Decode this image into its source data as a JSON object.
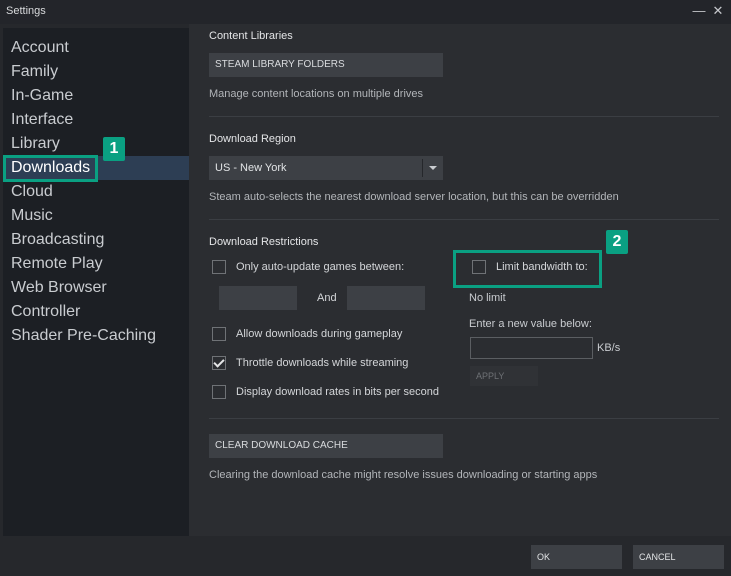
{
  "window": {
    "title": "Settings",
    "minimize_glyph": "—",
    "close_glyph": "✕"
  },
  "sidebar": {
    "active_item": "Downloads",
    "items": [
      {
        "label": "Account"
      },
      {
        "label": "Family"
      },
      {
        "label": "In-Game"
      },
      {
        "label": "Interface"
      },
      {
        "label": "Library"
      },
      {
        "label": "Downloads"
      },
      {
        "label": "Cloud"
      },
      {
        "label": "Music"
      },
      {
        "label": "Broadcasting"
      },
      {
        "label": "Remote Play"
      },
      {
        "label": "Web Browser"
      },
      {
        "label": "Controller"
      },
      {
        "label": "Shader Pre-Caching"
      }
    ]
  },
  "content_libraries": {
    "title": "Content Libraries",
    "button": "STEAM LIBRARY FOLDERS",
    "description": "Manage content locations on multiple drives"
  },
  "download_region": {
    "title": "Download Region",
    "selected": "US - New York",
    "description": "Steam auto-selects the nearest download server location, but this can be overridden"
  },
  "download_restrictions": {
    "title": "Download Restrictions",
    "auto_update": {
      "label": "Only auto-update games between:",
      "checked": false,
      "from": "",
      "to": "",
      "and_label": "And"
    },
    "allow_during_gameplay": {
      "label": "Allow downloads during gameplay",
      "checked": false
    },
    "throttle_streaming": {
      "label": "Throttle downloads while streaming",
      "checked": true
    },
    "bits_per_second": {
      "label": "Display download rates in bits per second",
      "checked": false
    },
    "bandwidth": {
      "label": "Limit bandwidth to:",
      "checked": false,
      "status": "No limit",
      "prompt": "Enter a new value below:",
      "value": "",
      "unit": "KB/s",
      "apply": "APPLY"
    }
  },
  "cache": {
    "button": "CLEAR DOWNLOAD CACHE",
    "description": "Clearing the download cache might resolve issues downloading or starting apps"
  },
  "footer": {
    "ok": "OK",
    "cancel": "CANCEL"
  },
  "annotations": [
    {
      "label": "1"
    },
    {
      "label": "2"
    }
  ],
  "colors": {
    "accent": "#0aa082",
    "sidebar_active": "#2d3e54",
    "sidebar_bg": "#1c1f24",
    "panel_bg": "#2b2d31"
  }
}
